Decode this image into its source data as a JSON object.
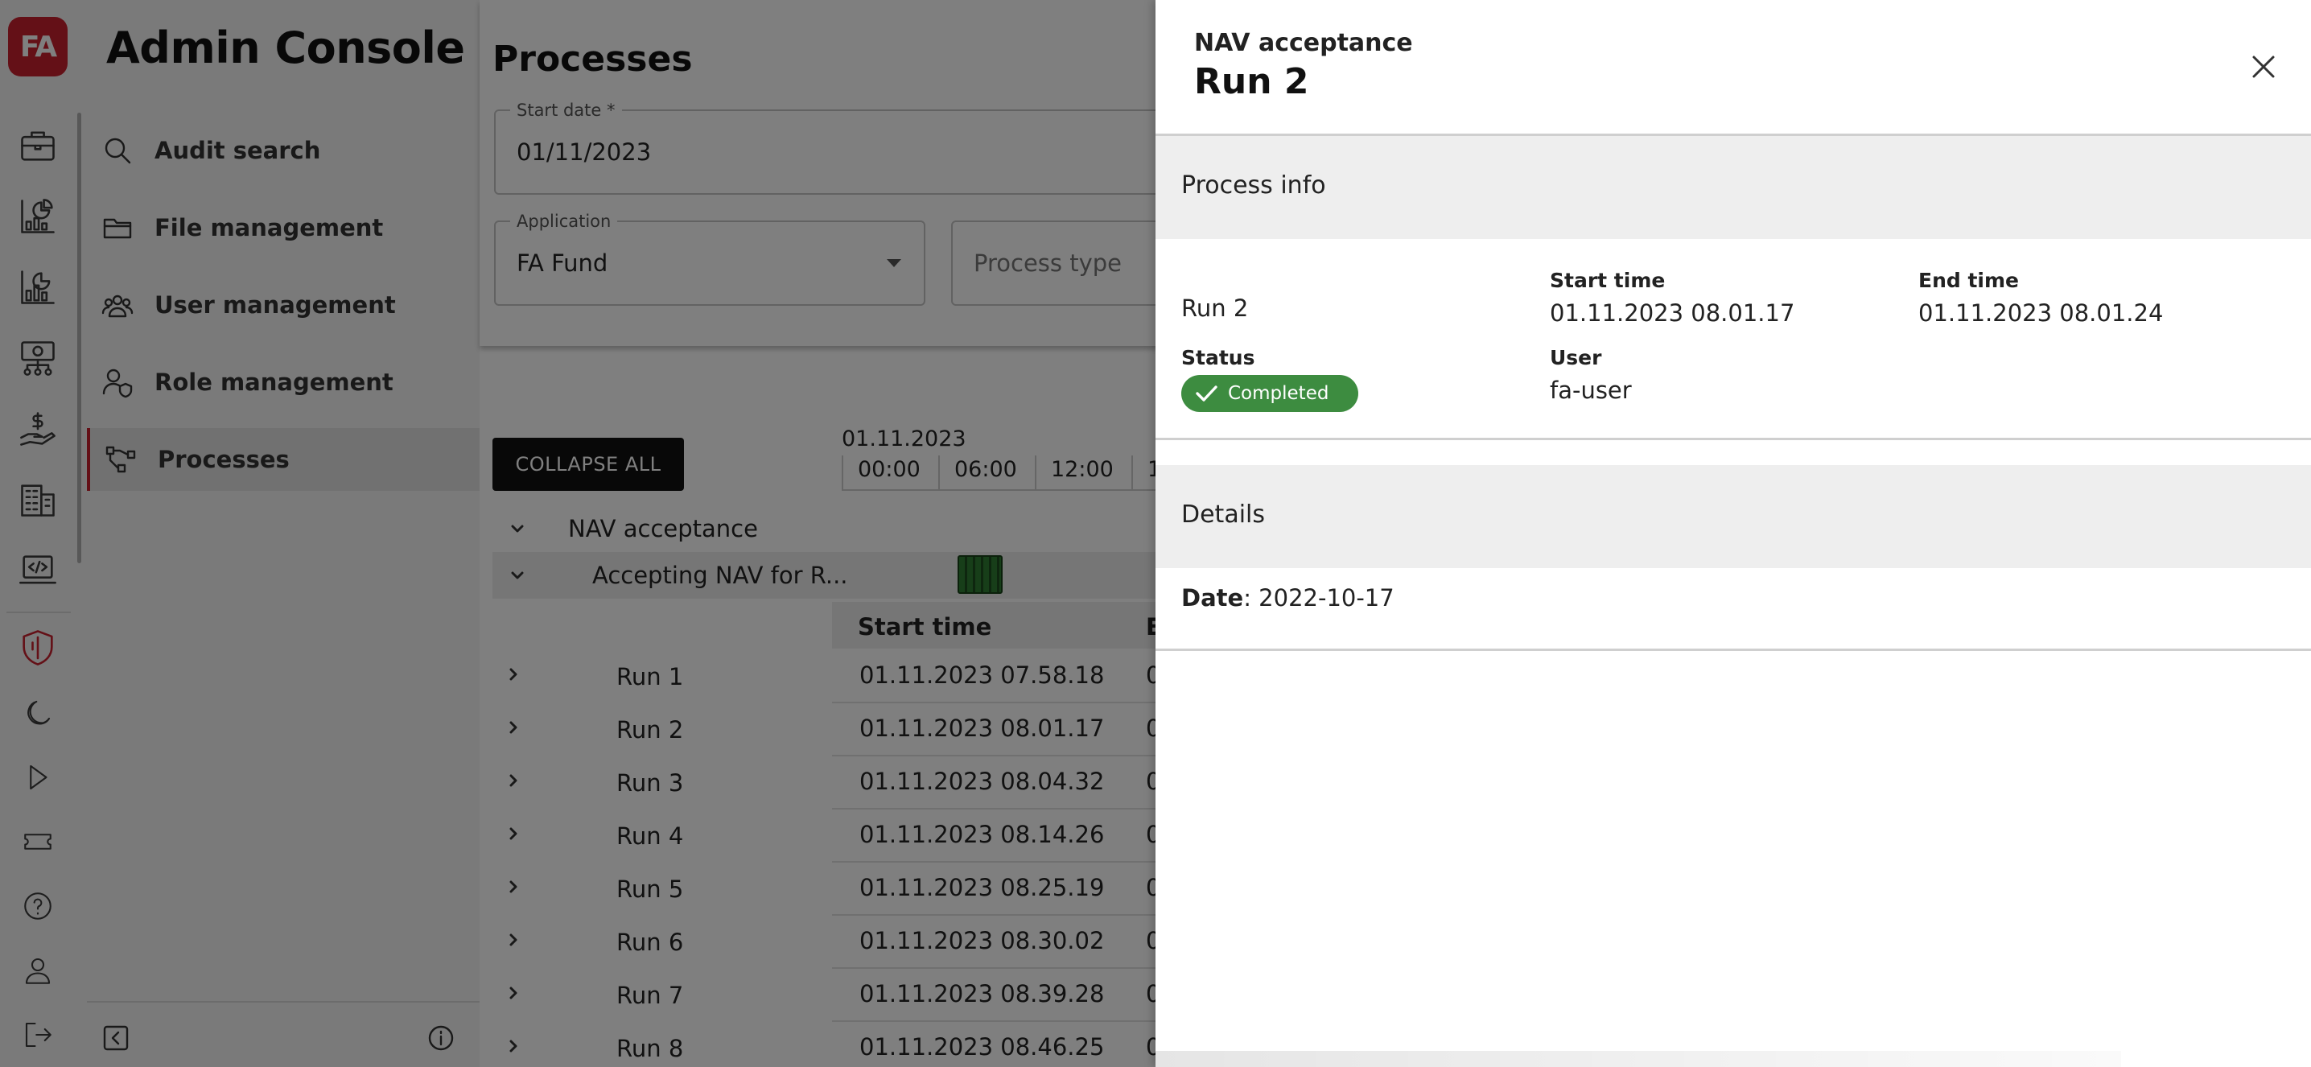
{
  "app": {
    "logo_text": "FA",
    "title": "Admin Console"
  },
  "rail": {
    "icons": [
      "briefcase-icon",
      "pie-chart-icon",
      "bar-chart-icon",
      "money-network-icon",
      "hand-money-icon",
      "building-icon",
      "code-laptop-icon",
      "shield-icon",
      "moon-icon",
      "play-icon",
      "ticket-icon",
      "help-icon",
      "person-icon",
      "logout-icon"
    ]
  },
  "nav": {
    "items": [
      {
        "label": "Audit search",
        "icon": "search-icon"
      },
      {
        "label": "File management",
        "icon": "folder-icon"
      },
      {
        "label": "User management",
        "icon": "users-icon"
      },
      {
        "label": "Role management",
        "icon": "user-shield-icon"
      },
      {
        "label": "Processes",
        "icon": "process-icon",
        "active": true
      }
    ]
  },
  "main": {
    "title": "Processes",
    "start_date": {
      "label": "Start date *",
      "value": "01/11/2023"
    },
    "application": {
      "label": "Application",
      "value": "FA Fund"
    },
    "process_type": {
      "placeholder": "Process type"
    },
    "collapse_all": "COLLAPSE ALL",
    "timeline": {
      "date": "01.11.2023",
      "ticks": [
        "00:00",
        "06:00",
        "12:00",
        "1"
      ]
    },
    "tree": {
      "group": "NAV acceptance",
      "subgroup": "Accepting NAV for R..."
    },
    "table": {
      "columns": [
        "Start time",
        "E"
      ],
      "rows": [
        {
          "name": "Run 1",
          "start": "01.11.2023 07.58.18",
          "end": "0"
        },
        {
          "name": "Run 2",
          "start": "01.11.2023 08.01.17",
          "end": "0"
        },
        {
          "name": "Run 3",
          "start": "01.11.2023 08.04.32",
          "end": "0"
        },
        {
          "name": "Run 4",
          "start": "01.11.2023 08.14.26",
          "end": "0"
        },
        {
          "name": "Run 5",
          "start": "01.11.2023 08.25.19",
          "end": "0"
        },
        {
          "name": "Run 6",
          "start": "01.11.2023 08.30.02",
          "end": "0"
        },
        {
          "name": "Run 7",
          "start": "01.11.2023 08.39.28",
          "end": "0"
        },
        {
          "name": "Run 8",
          "start": "01.11.2023 08.46.25",
          "end": "0"
        }
      ]
    }
  },
  "drawer": {
    "supertitle": "NAV acceptance",
    "title": "Run 2",
    "process_info": {
      "heading": "Process info",
      "name": "Run 2",
      "start_time_label": "Start time",
      "start_time": "01.11.2023 08.01.17",
      "end_time_label": "End time",
      "end_time": "01.11.2023 08.01.24",
      "status_label": "Status",
      "status": "Completed",
      "status_color": "#3d8c40",
      "user_label": "User",
      "user": "fa-user"
    },
    "details": {
      "heading": "Details",
      "date_key": "Date",
      "date_value": ": 2022-10-17"
    }
  },
  "colors": {
    "brand": "#c8202e",
    "status_completed": "#3d8c40"
  }
}
